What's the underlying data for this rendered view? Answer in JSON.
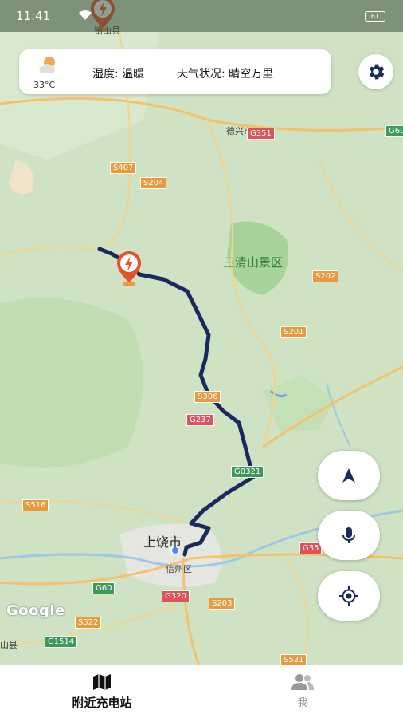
{
  "status_bar": {
    "time": "11:41",
    "battery": "61"
  },
  "weather": {
    "temperature": "33°C",
    "humidity": "湿度: 温暖",
    "condition": "天气状况: 晴空万里"
  },
  "map": {
    "labels": {
      "scenic": "三清山景区",
      "city": "上饶市",
      "district": "信州区",
      "dexing": "德兴市",
      "top_city": "铅山县",
      "yushan": "山县"
    },
    "roads": [
      {
        "name": "G351",
        "kind": "national"
      },
      {
        "name": "S407",
        "kind": "provincial"
      },
      {
        "name": "S204",
        "kind": "provincial"
      },
      {
        "name": "S202",
        "kind": "provincial"
      },
      {
        "name": "S201",
        "kind": "provincial"
      },
      {
        "name": "S306",
        "kind": "provincial"
      },
      {
        "name": "G237",
        "kind": "national"
      },
      {
        "name": "G0321",
        "kind": "expressway"
      },
      {
        "name": "S516",
        "kind": "provincial"
      },
      {
        "name": "G60",
        "kind": "expressway"
      },
      {
        "name": "G320",
        "kind": "national"
      },
      {
        "name": "S203",
        "kind": "provincial"
      },
      {
        "name": "S522",
        "kind": "provincial"
      },
      {
        "name": "G1514",
        "kind": "expressway"
      },
      {
        "name": "S521",
        "kind": "provincial"
      },
      {
        "name": "G35",
        "kind": "national"
      },
      {
        "name": "G60",
        "kind": "expressway"
      }
    ],
    "attribution": "Google"
  },
  "icons": {
    "charging_marker": "lightning-bolt-icon",
    "settings": "gear-icon",
    "navigate": "navigation-arrow-icon",
    "voice": "microphone-icon",
    "locate": "my-location-icon"
  },
  "tabs": [
    {
      "label": "附近充电站",
      "icon": "map-icon",
      "active": true
    },
    {
      "label": "我",
      "icon": "people-icon",
      "active": false
    }
  ],
  "colors": {
    "route": "#1a2a5e",
    "marker": "#e8502a",
    "national_road": "#e0525a",
    "provincial_road": "#e89a3c",
    "expressway": "#3c9a5a",
    "forest": "#a8d39a"
  }
}
